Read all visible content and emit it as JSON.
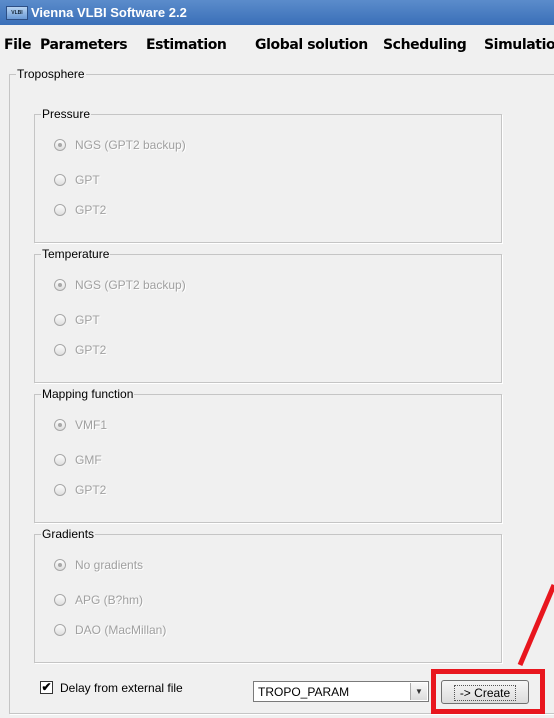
{
  "window": {
    "title": "Vienna VLBI Software 2.2",
    "icon": "app-icon"
  },
  "menu": [
    "File",
    "Parameters",
    "Estimation",
    "Global solution",
    "Scheduling",
    "Simulatio"
  ],
  "troposphere": {
    "title": "Troposphere",
    "pressure": {
      "title": "Pressure",
      "options": [
        "NGS (GPT2 backup)",
        "GPT",
        "GPT2"
      ],
      "selected": "NGS (GPT2 backup)"
    },
    "temperature": {
      "title": "Temperature",
      "options": [
        "NGS (GPT2 backup)",
        "GPT",
        "GPT2"
      ],
      "selected": "NGS (GPT2 backup)"
    },
    "mapping": {
      "title": "Mapping function",
      "options": [
        "VMF1",
        "GMF",
        "GPT2"
      ],
      "selected": "VMF1"
    },
    "gradients": {
      "title": "Gradients",
      "options": [
        "No gradients",
        "APG (B?hm)",
        "DAO (MacMillan)"
      ],
      "selected": "No gradients"
    }
  },
  "bottom": {
    "delay_checkbox_checked": true,
    "delay_label": "Delay from external file",
    "file_select_value": "TROPO_PARAM",
    "create_button_label": "-> Create"
  },
  "annotation": {
    "highlight_color": "#e8161e"
  }
}
